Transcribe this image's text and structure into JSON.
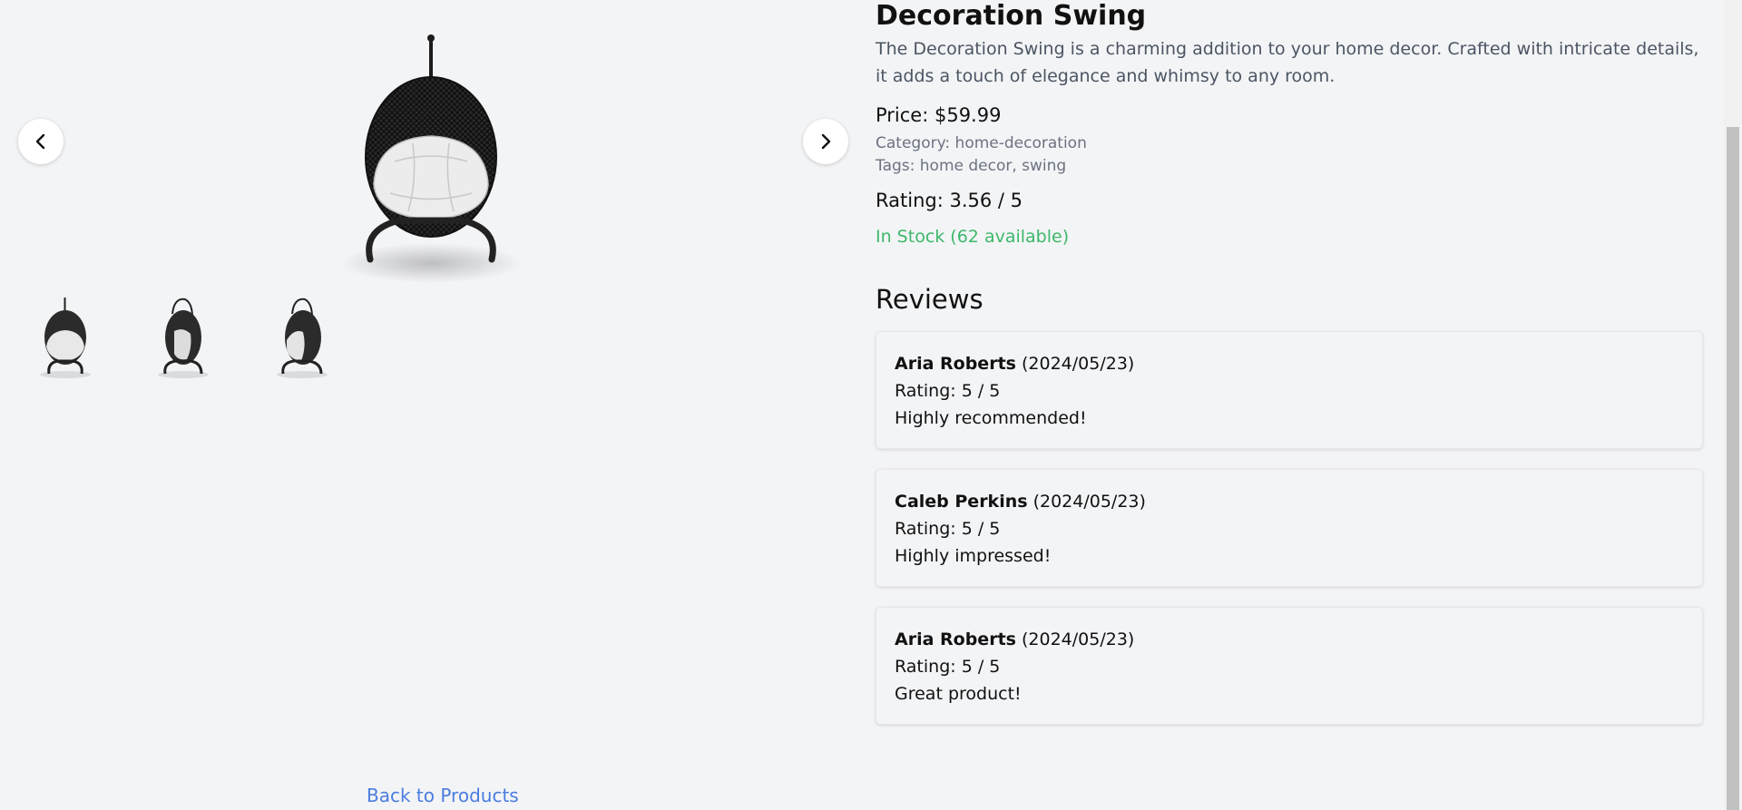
{
  "product": {
    "title": "Decoration Swing",
    "description": "The Decoration Swing is a charming addition to your home decor. Crafted with intricate details, it adds a touch of elegance and whimsy to any room.",
    "price_label": "Price: $59.99",
    "category_label": "Category: home-decoration",
    "tags_label": "Tags: home decor, swing",
    "rating_label": "Rating: 3.56 / 5",
    "stock_label": "In Stock (62 available)",
    "stock_color": "#3cb86a"
  },
  "gallery": {
    "prev_icon": "chevron-left-icon",
    "next_icon": "chevron-right-icon",
    "thumbnail_count": 3
  },
  "reviews": {
    "heading": "Reviews",
    "items": [
      {
        "author": "Aria Roberts",
        "date": " (2024/05/23)",
        "rating": "Rating: 5 / 5",
        "comment": "Highly recommended!"
      },
      {
        "author": "Caleb Perkins",
        "date": " (2024/05/23)",
        "rating": "Rating: 5 / 5",
        "comment": "Highly impressed!"
      },
      {
        "author": "Aria Roberts",
        "date": " (2024/05/23)",
        "rating": "Rating: 5 / 5",
        "comment": "Great product!"
      }
    ]
  },
  "footer": {
    "back_link": "Back to Products",
    "link_color": "#4a7de0"
  }
}
